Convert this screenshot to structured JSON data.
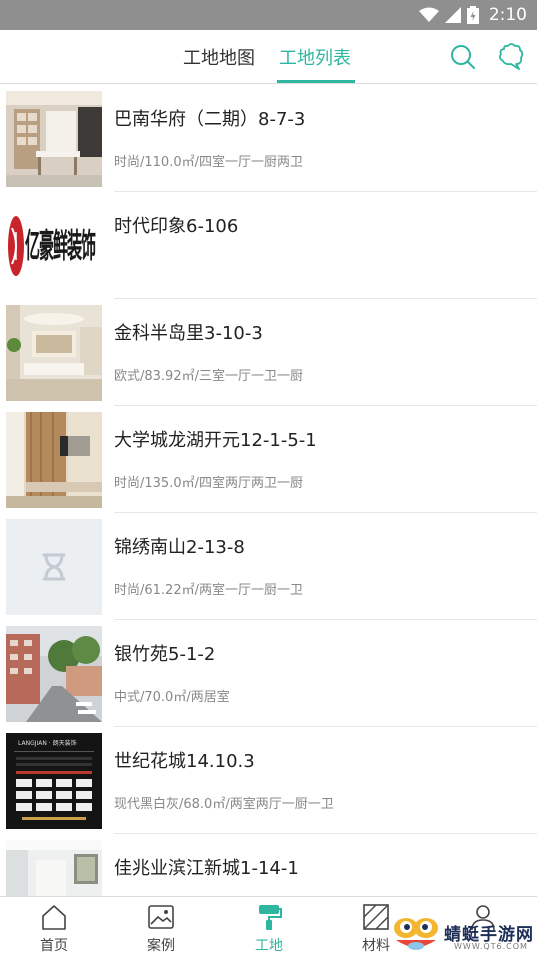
{
  "status": {
    "time": "2:10",
    "colors": {
      "bar": "#8f8f8f"
    },
    "icons": [
      "wifi-icon",
      "signal-icon",
      "battery-icon"
    ]
  },
  "header": {
    "tabs": [
      {
        "label": "工地地图",
        "active": false
      },
      {
        "label": "工地列表",
        "active": true
      }
    ],
    "icons": [
      "search-icon",
      "chat-icon"
    ],
    "accent": "#2fb6a0"
  },
  "list": {
    "items": [
      {
        "title": "巴南华府（二期）8-7-3",
        "subtitle": "时尚/110.0㎡/四室一厅一厨两卫",
        "thumb": "interior-dining-photo"
      },
      {
        "title": "时代印象6-106",
        "subtitle": "",
        "thumb": "logo-image",
        "logo_text": "亿豪鲜装饰"
      },
      {
        "title": "金科半岛里3-10-3",
        "subtitle": "欧式/83.92㎡/三室一厅一卫一厨",
        "thumb": "living-room-photo"
      },
      {
        "title": "大学城龙湖开元12-1-5-1",
        "subtitle": "时尚/135.0㎡/四室两厅两卫一厨",
        "thumb": "wood-tv-wall-photo"
      },
      {
        "title": "锦绣南山2-13-8",
        "subtitle": "时尚/61.22㎡/两室一厅一厨一卫",
        "thumb": "hourglass-placeholder-icon"
      },
      {
        "title": "银竹苑5-1-2",
        "subtitle": "中式/70.0㎡/两居室",
        "thumb": "street-photo"
      },
      {
        "title": "世纪花城14.10.3",
        "subtitle": "现代黑白灰/68.0㎡/两室两厅一厨一卫",
        "thumb": "flyer-photo",
        "flyer_text": "LANGJIAN · 朗天装饰"
      },
      {
        "title": "佳兆业滨江新城1-14-1",
        "subtitle": "",
        "thumb": "hallway-photo"
      }
    ]
  },
  "nav": {
    "items": [
      {
        "label": "首页",
        "icon": "home-icon",
        "active": false
      },
      {
        "label": "案例",
        "icon": "image-icon",
        "active": false
      },
      {
        "label": "工地",
        "icon": "paint-roller-icon",
        "active": true
      },
      {
        "label": "材料",
        "icon": "tile-icon",
        "active": false
      },
      {
        "label": "",
        "icon": "user-icon",
        "active": false
      }
    ]
  },
  "watermark": {
    "text": "蜻蜓手游网",
    "url": "WWW.QT6.COM"
  }
}
